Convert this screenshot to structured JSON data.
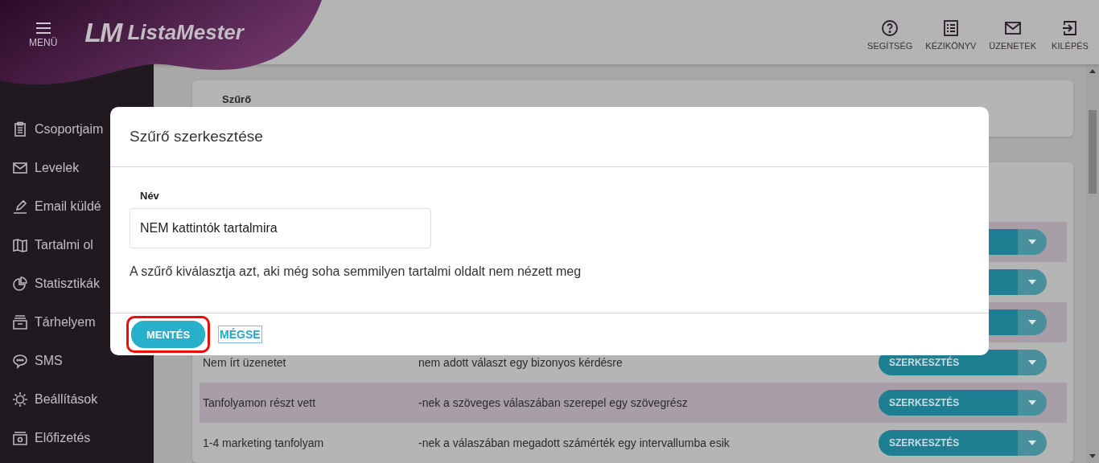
{
  "header": {
    "menu_label": "MENÜ",
    "logo_mark": "LM",
    "logo_text": "ListaMester",
    "actions": [
      {
        "label": "SEGÍTSÉG"
      },
      {
        "label": "KÉZIKÖNYV"
      },
      {
        "label": "ÜZENETEK"
      },
      {
        "label": "KILÉPÉS"
      }
    ]
  },
  "sidebar": {
    "items": [
      {
        "label": "Csoportjaim"
      },
      {
        "label": "Levelek"
      },
      {
        "label": "Email küldé"
      },
      {
        "label": "Tartalmi ol"
      },
      {
        "label": "Statisztikák"
      },
      {
        "label": "Tárhelyem"
      },
      {
        "label": "SMS"
      },
      {
        "label": "Beállítások"
      },
      {
        "label": "Előfizetés"
      }
    ]
  },
  "filter_card": {
    "title": "Szűrő"
  },
  "table": {
    "rows": [
      {
        "name": "Nem írt üzenetet",
        "description": "nem adott választ egy bizonyos kérdésre",
        "button": "SZERKESZTÉS",
        "shaded": false
      },
      {
        "name": "Tanfolyamon részt vett",
        "description": "-nek a szöveges válaszában szerepel egy szövegrész",
        "button": "SZERKESZTÉS",
        "shaded": true
      },
      {
        "name": "1-4 marketing tanfolyam",
        "description": "-nek a válaszában megadott számérték egy intervallumba esik",
        "button": "SZERKESZTÉS",
        "shaded": false
      }
    ]
  },
  "dialog": {
    "title": "Szűrő szerkesztése",
    "field_label": "Név",
    "field_value": "NEM kattintók tartalmira",
    "description": "A szűrő kiválasztja azt, aki még soha semmilyen tartalmi oldalt nem nézett meg",
    "save": {
      "label": "MENTÉS",
      "highlighted": true
    },
    "cancel": "MÉGSE"
  }
}
